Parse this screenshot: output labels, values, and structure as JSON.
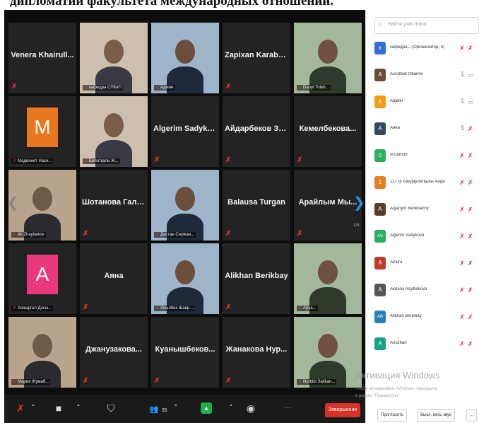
{
  "caption": "дипломатии факультета международных отношений.",
  "tiles": [
    {
      "row": 0,
      "col": 0,
      "type": "name",
      "name": "Venera Khairull..."
    },
    {
      "row": 0,
      "col": 1,
      "type": "photo",
      "tag": "кафедра СПКиП"
    },
    {
      "row": 0,
      "col": 2,
      "type": "photo",
      "tag": "Админ"
    },
    {
      "row": 0,
      "col": 3,
      "type": "name",
      "name": "Zapixan Karaba..."
    },
    {
      "row": 0,
      "col": 4,
      "type": "photo",
      "tag": "Dauyt Toleb..."
    },
    {
      "row": 1,
      "col": 0,
      "type": "avatar",
      "letter": "M",
      "color": "#e8771e",
      "tag": "Мадениет Наси..."
    },
    {
      "row": 1,
      "col": 1,
      "type": "photo",
      "tag": "Болатқали Ж..."
    },
    {
      "row": 1,
      "col": 2,
      "type": "name",
      "name": "Algerim Sadyko..."
    },
    {
      "row": 1,
      "col": 3,
      "type": "name",
      "name": "Айдарбеков Зе..."
    },
    {
      "row": 1,
      "col": 4,
      "type": "name",
      "name": "Кемелбекова..."
    },
    {
      "row": 2,
      "col": 0,
      "type": "photo",
      "tag": "Ali Zhaybekov"
    },
    {
      "row": 2,
      "col": 1,
      "type": "name",
      "name": "Шотанова Гали..."
    },
    {
      "row": 2,
      "col": 2,
      "type": "photo",
      "tag": "Дастан Серікан..."
    },
    {
      "row": 2,
      "col": 3,
      "type": "name",
      "name": "Balausa Turgan"
    },
    {
      "row": 2,
      "col": 4,
      "type": "name",
      "name": "Арайлым Мы..."
    },
    {
      "row": 3,
      "col": 0,
      "type": "avatar",
      "letter": "A",
      "color": "#e83a7a",
      "tag": "Аяжаргал Досы..."
    },
    {
      "row": 3,
      "col": 1,
      "type": "name",
      "name": "Аяна"
    },
    {
      "row": 3,
      "col": 2,
      "type": "photo",
      "tag": "Асылбек Шаир...",
      "speaking": true
    },
    {
      "row": 3,
      "col": 3,
      "type": "name",
      "name": "Alikhan Berikbay"
    },
    {
      "row": 3,
      "col": 4,
      "type": "photo",
      "tag": "Аруа..."
    },
    {
      "row": 4,
      "col": 0,
      "type": "photo",
      "tag": "Мария Жумаб..."
    },
    {
      "row": 4,
      "col": 1,
      "type": "name",
      "name": "Джанузакова..."
    },
    {
      "row": 4,
      "col": 2,
      "type": "name",
      "name": "Куанышбеков..."
    },
    {
      "row": 4,
      "col": 3,
      "type": "name",
      "name": "Жанакова Нур..."
    },
    {
      "row": 4,
      "col": 4,
      "type": "photo",
      "tag": "Nurbibi Salikan..."
    }
  ],
  "page_indicator_left": "1/4",
  "page_indicator_right": "1/4",
  "toolbar": {
    "mute_icon": "✗",
    "video_icon": "■",
    "security_icon": "⛉",
    "participants_icon": "👥",
    "participants_count": "35",
    "share_icon": "▲",
    "record_icon": "◉",
    "more_icon": "···",
    "end_label": "Завершение"
  },
  "panel": {
    "search_placeholder": "Найти участника",
    "participants": [
      {
        "name": "кафедра... (Организатор, я)",
        "letter": "к",
        "color": "#2f6fd6",
        "mic": "muted",
        "cam": "muted"
      },
      {
        "name": "Assylbek Izbairov",
        "letter": "A",
        "color": "#6b4a3a",
        "mic": "on",
        "cam": "on"
      },
      {
        "name": "Админ",
        "letter": "A",
        "color": "#f39c12",
        "mic": "on",
        "cam": "on"
      },
      {
        "name": "Аяна",
        "letter": "A",
        "color": "#34495e",
        "mic": "on",
        "cam": "muted"
      },
      {
        "name": "001km06",
        "letter": "0",
        "color": "#27ae60",
        "mic": "muted",
        "cam": "muted"
      },
      {
        "name": "117 гр Бахдаулетқызы Аида",
        "letter": "1",
        "color": "#e67e22",
        "mic": "muted",
        "cam": "muted"
      },
      {
        "name": "Aiganym Berikbazhy",
        "letter": "A",
        "color": "#5a3d2b",
        "mic": "muted",
        "cam": "muted"
      },
      {
        "name": "Algerim Sadykova",
        "letter": "AS",
        "color": "#27ae60",
        "mic": "muted",
        "cam": "muted"
      },
      {
        "name": "Ainura",
        "letter": "A",
        "color": "#c0392b",
        "mic": "muted",
        "cam": "muted"
      },
      {
        "name": "Akdana Asylbekova",
        "letter": "A",
        "color": "#555555",
        "mic": "muted",
        "cam": "muted"
      },
      {
        "name": "Alikhan Berikbay",
        "letter": "AB",
        "color": "#2980b9",
        "mic": "muted",
        "cam": "muted"
      },
      {
        "name": "Anuzhan",
        "letter": "A",
        "color": "#16a085",
        "mic": "muted",
        "cam": "muted"
      }
    ],
    "invite_label": "Пригласить",
    "mute_all_label": "Выкл. весь звук",
    "more_label": "..."
  },
  "watermark": {
    "line1": "Активация Windows",
    "line2": "Чтобы активировать Windows, перейдите",
    "line3": "в раздел \"Параметры\"."
  }
}
